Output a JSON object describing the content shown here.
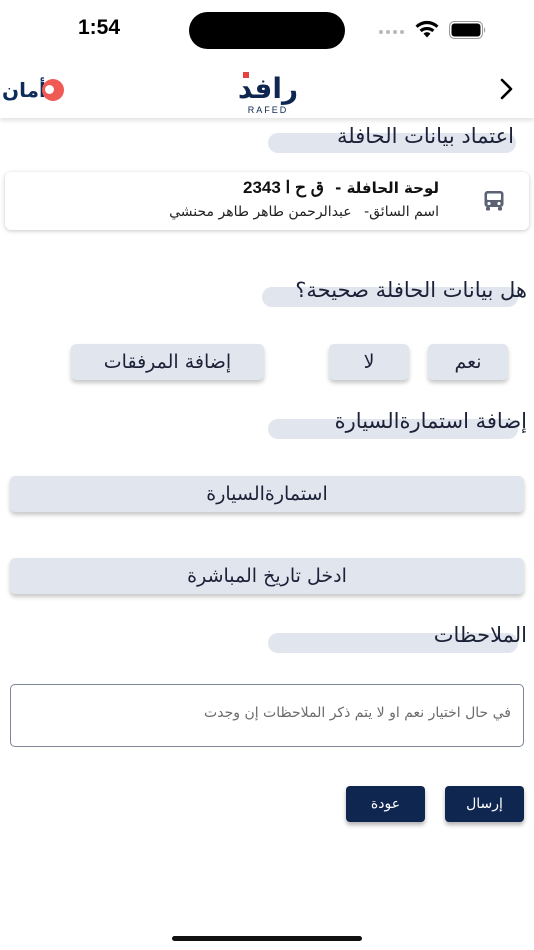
{
  "status_bar": {
    "time": "1:54"
  },
  "header": {
    "left_logo_text": "أمان",
    "center_logo_text": "رافد",
    "center_logo_subtext": "RAFED",
    "back_icon": "chevron-right-icon"
  },
  "bus_section": {
    "title": "اعتماد بيانات الحافلة",
    "plate_label": "لوحة الحافلة -",
    "plate_value": "ق ح ا 2343",
    "driver_label": "اسم السائق-",
    "driver_name": "عبدالرحمن طاهر طاهر محنشي",
    "icon": "bus-icon"
  },
  "question": {
    "title": "هل بيانات الحافلة صحيحة؟",
    "yes_label": "نعم",
    "no_label": "لا",
    "attachments_label": "إضافة المرفقات"
  },
  "vehicle_form": {
    "title": "إضافة استمارةالسيارة",
    "form_button_label": "استمارةالسيارة",
    "date_button_label": "ادخل تاريخ المباشرة"
  },
  "notes": {
    "title": "الملاحظات",
    "placeholder": "في حال اختيار نعم او لا يتم ذكر الملاحظات إن وجدت",
    "value": ""
  },
  "actions": {
    "submit_label": "إرسال",
    "back_label": "عودة"
  },
  "colors": {
    "primary_dark": "#0e2650",
    "button_light": "#e1e5ee",
    "brand_red": "#f05a55",
    "text_dark": "#1b2237"
  }
}
